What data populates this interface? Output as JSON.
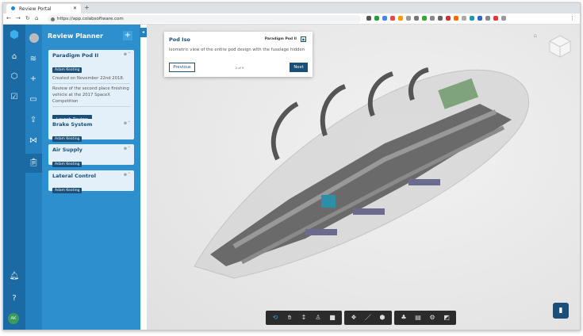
{
  "browser": {
    "tab_title": "Review Portal",
    "url": "https://app.colabsoftware.com"
  },
  "colors": {
    "rail": "#1b6aa3",
    "panel": "#2e8fcf",
    "accent": "#1b4f78",
    "active_tool": "#29a3e8"
  },
  "panel": {
    "title": "Review Planner",
    "add_label": "+",
    "cards": [
      {
        "title": "Paradigm Pod II",
        "owner": "Adam Keating",
        "created": "Created on November 22nd 2018.",
        "description": "Review of the second place finishing vehicle at the 2017 SpaceX Competition",
        "button": "Launch Review",
        "expanded": true
      },
      {
        "title": "Brake System",
        "owner": "Adam Keating",
        "expanded": false
      },
      {
        "title": "Air Supply",
        "owner": "Adam Keating",
        "expanded": false
      },
      {
        "title": "Lateral Control",
        "owner": "Adam Keating",
        "expanded": false
      }
    ]
  },
  "popup": {
    "title": "Pod Iso",
    "project": "Paradigm Pod II",
    "description": "Isometric view of the entire pod design with the fuselage hidden",
    "previous": "Previous",
    "counter": "2 of 9",
    "next": "Next"
  },
  "toolbar": {
    "groups": [
      [
        "orbit-icon",
        "pan-icon",
        "zoom-icon",
        "person-icon",
        "camera-icon"
      ],
      [
        "explode-icon",
        "measure-icon",
        "section-icon"
      ],
      [
        "tree-icon",
        "document-icon",
        "settings-icon",
        "fullscreen-icon"
      ]
    ]
  }
}
